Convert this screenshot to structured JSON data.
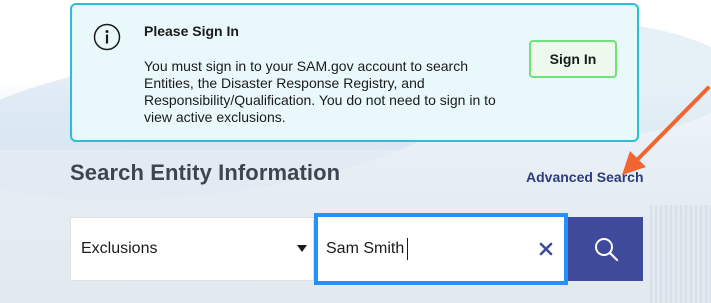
{
  "alert": {
    "title": "Please Sign In",
    "body": "You must sign in to your SAM.gov account to search Entities, the Disaster Response Registry, and Responsibility/Qualification. You do not need to sign in to view active exclusions.",
    "signin_label": "Sign In",
    "icon": "info-icon",
    "border_color": "#2bbfd6",
    "background_color": "#e9f8fb"
  },
  "search": {
    "section_title": "Search Entity Information",
    "advanced_link": "Advanced Search",
    "domain_selected": "Exclusions",
    "query_value": "Sam Smith",
    "clear_icon": "close-icon",
    "submit_icon": "search-icon",
    "focus_color": "#2491ff",
    "button_color": "#3f4a9a"
  },
  "annotation": {
    "arrow_color": "#f26531",
    "arrow_target": "Advanced Search"
  }
}
